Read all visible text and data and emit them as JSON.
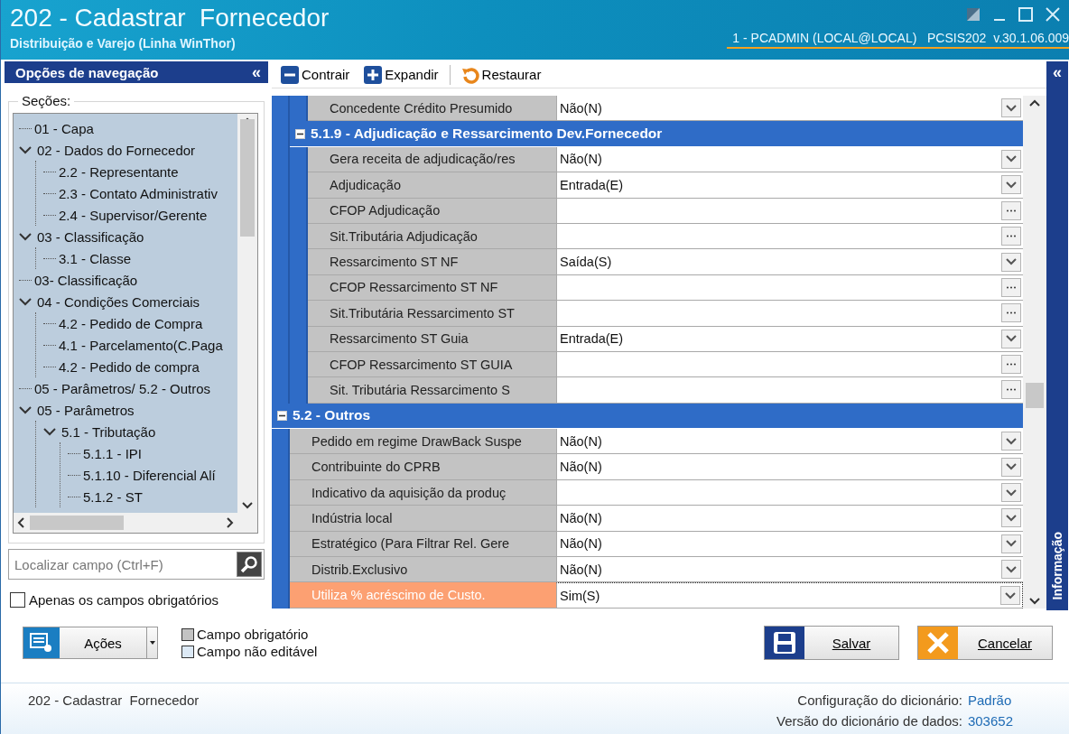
{
  "window": {
    "title": "202 - Cadastrar  Fornecedor",
    "subtitle": "Distribuição e Varejo (Linha WinThor)",
    "session": "1 - PCADMIN (LOCAL@LOCAL)   PCSIS202  v.30.1.06.009"
  },
  "navigation": {
    "title": "Opções de navegação",
    "collapse": "«",
    "sections_label": "Seções:",
    "tree": [
      {
        "label": "01 - Capa"
      },
      {
        "label": "02 - Dados do Fornecedor",
        "expanded": true,
        "children": [
          {
            "label": "2.2 - Representante"
          },
          {
            "label": "2.3 - Contato Administrativ"
          },
          {
            "label": "2.4 - Supervisor/Gerente"
          }
        ]
      },
      {
        "label": "03 - Classificação",
        "expanded": true,
        "children": [
          {
            "label": "3.1 - Classe"
          }
        ]
      },
      {
        "label": "03- Classificação"
      },
      {
        "label": "04 - Condições Comerciais",
        "expanded": true,
        "children": [
          {
            "label": " 4.2 - Pedido de Compra"
          },
          {
            "label": "4.1 - Parcelamento(C.Paga"
          },
          {
            "label": "4.2 - Pedido de compra"
          }
        ]
      },
      {
        "label": "05 - Parâmetros/ 5.2 - Outros"
      },
      {
        "label": "05 - Parâmetros",
        "expanded": true,
        "children": [
          {
            "label": "5.1 - Tributação",
            "expanded": true,
            "children": [
              {
                "label": "5.1.1 - IPI"
              },
              {
                "label": "5.1.10 - Diferencial Alí"
              },
              {
                "label": "5.1.2 - ST"
              }
            ]
          }
        ]
      }
    ],
    "search": {
      "placeholder": "Localizar campo (Ctrl+F)"
    },
    "only_required": {
      "label": "Apenas os campos obrigatórios",
      "checked": false
    }
  },
  "toolbar": [
    {
      "kind": "collapse",
      "label": "Contrair"
    },
    {
      "kind": "expand",
      "label": "Expandir"
    },
    {
      "kind": "restore",
      "label": "Restaurar"
    }
  ],
  "grid": [
    {
      "kind": "group",
      "children": [
        {
          "kind": "group",
          "children": [
            {
              "kind": "dropdown",
              "label": "Concedente Crédito Presumido",
              "value": "Não(N)",
              "selected": false
            }
          ]
        },
        {
          "kind": "section",
          "title": "5.1.9 - Adjudicação e Ressarcimento Dev.Fornecedor",
          "expanded": true,
          "children": [
            {
              "kind": "dropdown",
              "label": "Gera receita de adjudicação/res",
              "value": "Não(N)",
              "selected": false
            },
            {
              "kind": "dropdown",
              "label": "Adjudicação",
              "value": "Entrada(E)",
              "selected": false
            },
            {
              "kind": "picker",
              "label": "CFOP Adjudicação",
              "selected": false
            },
            {
              "kind": "picker",
              "label": "Sit.Tributária Adjudicação",
              "selected": false
            },
            {
              "kind": "dropdown",
              "label": "Ressarcimento ST NF",
              "value": "Saída(S)",
              "selected": false
            },
            {
              "kind": "picker",
              "label": "CFOP Ressarcimento ST NF",
              "selected": false
            },
            {
              "kind": "picker",
              "label": "Sit.Tributária Ressarcimento ST",
              "selected": false
            },
            {
              "kind": "dropdown",
              "label": "Ressarcimento ST Guia",
              "value": "Entrada(E)",
              "selected": false
            },
            {
              "kind": "picker",
              "label": "CFOP Ressarcimento ST GUIA",
              "selected": false
            },
            {
              "kind": "picker",
              "label": "Sit. Tributária Ressarcimento S",
              "selected": false
            }
          ]
        }
      ]
    },
    {
      "kind": "section",
      "title": "5.2 - Outros",
      "expanded": true,
      "children": [
        {
          "kind": "dropdown",
          "label": "Pedido em regime DrawBack Suspe",
          "value": "Não(N)",
          "selected": false
        },
        {
          "kind": "dropdown",
          "label": "Contribuinte do CPRB",
          "value": "Não(N)",
          "selected": false
        },
        {
          "kind": "dropdown",
          "label": "Indicativo da aquisição da produç",
          "selected": false
        },
        {
          "kind": "dropdown",
          "label": "Indústria local",
          "value": "Não(N)",
          "selected": false
        },
        {
          "kind": "dropdown",
          "label": "Estratégico  (Para Filtrar Rel. Gere",
          "value": "Não(N)",
          "selected": false
        },
        {
          "kind": "dropdown",
          "label": "Distrib.Exclusivo",
          "value": "Não(N)",
          "selected": false
        },
        {
          "kind": "dropdown",
          "label": "Utiliza % acréscimo de Custo.",
          "value": "Sim(S)",
          "selected": true
        }
      ]
    }
  ],
  "info_panel": {
    "collapse": "«",
    "title": "Informação"
  },
  "actions_button": {
    "label": "Ações"
  },
  "legend": [
    {
      "kind": "required",
      "label": "Campo obrigatório"
    },
    {
      "kind": "readonly",
      "label": "Campo não editável"
    }
  ],
  "buttons": [
    {
      "kind": "save",
      "label": "Salvar"
    },
    {
      "kind": "cancel",
      "label": "Cancelar"
    }
  ],
  "footer": {
    "routine": "202 - Cadastrar  Fornecedor",
    "info": [
      {
        "label": "Configuração do dicionário:",
        "value": "Padrão"
      },
      {
        "label": "Versão do dicionário de dados:",
        "value": "303652"
      }
    ]
  }
}
